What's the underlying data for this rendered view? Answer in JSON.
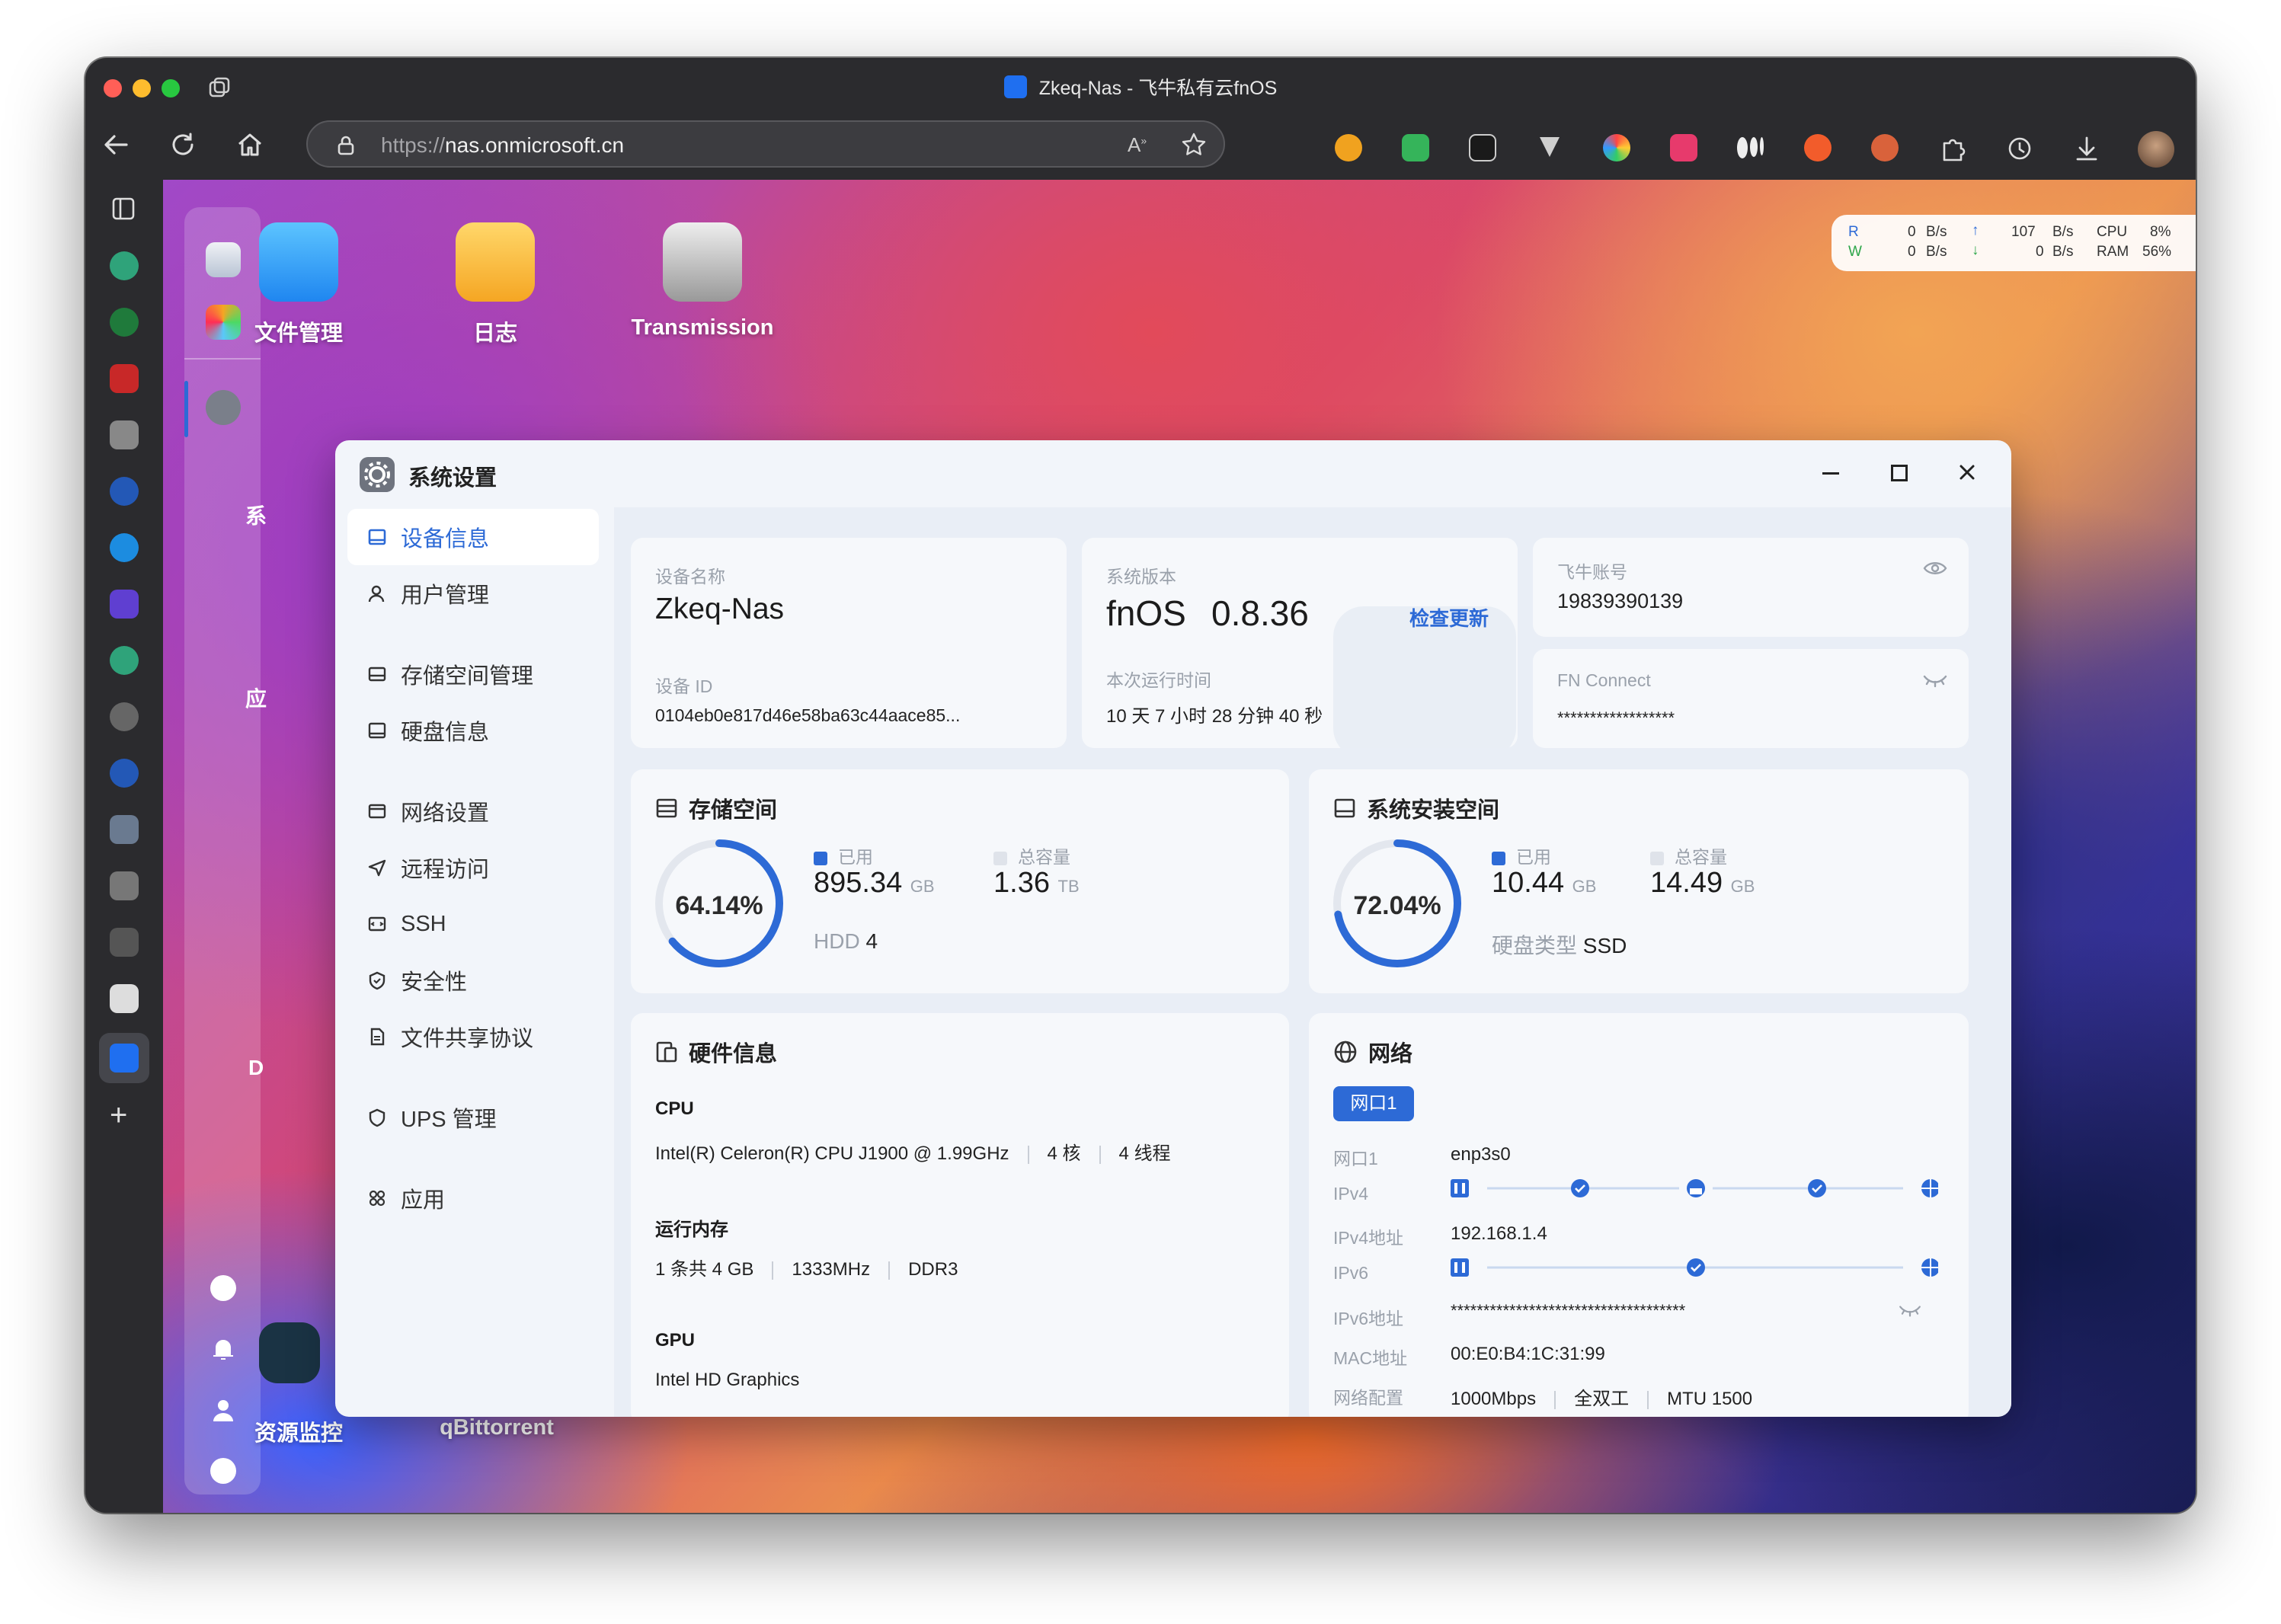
{
  "browser": {
    "window_title": "Zkeq-Nas - 飞牛私有云fnOS",
    "url_scheme": "https://",
    "url_host": "nas.onmicrosoft.cn"
  },
  "desktop": {
    "icons": [
      {
        "label": "文件管理"
      },
      {
        "label": "日志"
      },
      {
        "label": "Transmission"
      },
      {
        "label": "资源监控"
      },
      {
        "label": "qBittorrent"
      }
    ],
    "partial_labels": [
      "系",
      "应",
      "D"
    ]
  },
  "net_widget": {
    "r_label": "R",
    "w_label": "W",
    "read_speed": "0",
    "write_speed": "0",
    "up_speed": "107",
    "down_speed": "0",
    "unit": "B/s",
    "cpu_label": "CPU",
    "cpu_value": "8%",
    "ram_label": "RAM",
    "ram_value": "56%"
  },
  "settings": {
    "title": "系统设置",
    "nav": [
      {
        "label": "设备信息",
        "active": true
      },
      {
        "label": "用户管理"
      },
      {
        "label": "存储空间管理"
      },
      {
        "label": "硬盘信息"
      },
      {
        "label": "网络设置"
      },
      {
        "label": "远程访问"
      },
      {
        "label": "SSH"
      },
      {
        "label": "安全性"
      },
      {
        "label": "文件共享协议"
      },
      {
        "label": "UPS 管理"
      },
      {
        "label": "应用"
      }
    ],
    "device": {
      "name_label": "设备名称",
      "name": "Zkeq-Nas",
      "id_label": "设备 ID",
      "id": "0104eb0e817d46e58ba63c44aace85..."
    },
    "system": {
      "version_label": "系统版本",
      "os": "fnOS",
      "version": "0.8.36",
      "check_update": "检查更新",
      "uptime_label": "本次运行时间",
      "uptime": "10 天 7 小时 28 分钟 40 秒"
    },
    "account": {
      "label": "飞牛账号",
      "value": "19839390139"
    },
    "fn_connect": {
      "label": "FN Connect",
      "value": "******************"
    },
    "storage": {
      "title": "存储空间",
      "percent": "64.14%",
      "percent_value": 0.6414,
      "used_label": "已用",
      "used": "895.34",
      "used_unit": "GB",
      "total_label": "总容量",
      "total": "1.36",
      "total_unit": "TB",
      "hdd_label": "HDD",
      "hdd_count": "4"
    },
    "sys_storage": {
      "title": "系统安装空间",
      "percent": "72.04%",
      "percent_value": 0.7204,
      "used_label": "已用",
      "used": "10.44",
      "used_unit": "GB",
      "total_label": "总容量",
      "total": "14.49",
      "total_unit": "GB",
      "disk_type_label": "硬盘类型",
      "disk_type": "SSD"
    },
    "hardware": {
      "title": "硬件信息",
      "cpu_label": "CPU",
      "cpu_model": "Intel(R) Celeron(R) CPU J1900 @ 1.99GHz",
      "cpu_cores": "4 核",
      "cpu_threads": "4 线程",
      "mem_label": "运行内存",
      "mem_size": "1 条共 4 GB",
      "mem_freq": "1333MHz",
      "mem_type": "DDR3",
      "gpu_label": "GPU",
      "gpu_model": "Intel HD Graphics"
    },
    "network": {
      "title": "网络",
      "port_tab": "网口1",
      "port_label": "网口1",
      "port_value": "enp3s0",
      "ipv4_label": "IPv4",
      "ipv4_addr_label": "IPv4地址",
      "ipv4_addr": "192.168.1.4",
      "ipv6_label": "IPv6",
      "ipv6_addr_label": "IPv6地址",
      "ipv6_addr": "************************************",
      "mac_label": "MAC地址",
      "mac": "00:E0:B4:1C:31:99",
      "config_label": "网络配置",
      "speed": "1000Mbps",
      "duplex": "全双工",
      "mtu": "MTU 1500"
    }
  },
  "colors": {
    "accent": "#2d6ad6",
    "ring_track": "#e3e7ee"
  }
}
